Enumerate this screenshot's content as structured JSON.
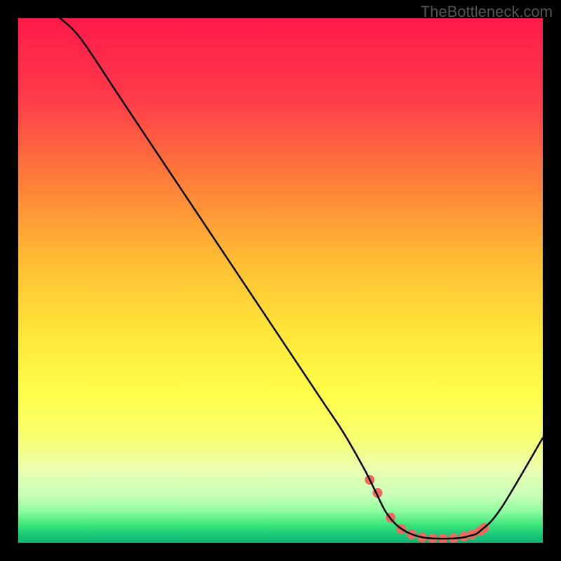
{
  "watermark": "TheBottleneck.com",
  "chart_data": {
    "type": "line",
    "title": "",
    "xlabel": "",
    "ylabel": "",
    "xlim": [
      0,
      100
    ],
    "ylim": [
      0,
      100
    ],
    "curve": {
      "x": [
        8,
        12,
        20,
        30,
        40,
        50,
        58,
        62,
        66,
        68,
        70,
        72,
        74,
        76,
        78,
        80,
        82,
        84,
        86,
        88,
        92,
        100
      ],
      "y": [
        100,
        96,
        84,
        69,
        54,
        39,
        27,
        21,
        14,
        10,
        6,
        3.5,
        2.1,
        1.3,
        0.9,
        0.8,
        0.8,
        0.9,
        1.3,
        2.2,
        6.5,
        20
      ]
    },
    "markers": {
      "x": [
        67,
        68.5,
        71,
        73,
        75,
        77,
        79,
        81,
        83,
        85,
        86.5,
        88,
        88.8
      ],
      "y": [
        12,
        9.5,
        4.8,
        2.6,
        1.6,
        1.0,
        0.8,
        0.8,
        0.9,
        1.2,
        1.6,
        2.2,
        2.8
      ]
    },
    "gradient_stops": [
      {
        "offset": 0.0,
        "color": "#ff1a4a"
      },
      {
        "offset": 0.15,
        "color": "#ff3a4a"
      },
      {
        "offset": 0.3,
        "color": "#ff7a3a"
      },
      {
        "offset": 0.45,
        "color": "#ffb933"
      },
      {
        "offset": 0.6,
        "color": "#ffe63a"
      },
      {
        "offset": 0.72,
        "color": "#ffff4a"
      },
      {
        "offset": 0.8,
        "color": "#f8ff70"
      },
      {
        "offset": 0.86,
        "color": "#eaffb0"
      },
      {
        "offset": 0.91,
        "color": "#c8ffb8"
      },
      {
        "offset": 0.94,
        "color": "#8efc9e"
      },
      {
        "offset": 0.965,
        "color": "#3de57a"
      },
      {
        "offset": 0.985,
        "color": "#18c978"
      },
      {
        "offset": 1.0,
        "color": "#0fb574"
      }
    ],
    "marker_style": {
      "fill": "#ec6b5f",
      "radius": 7
    },
    "line_style": {
      "stroke": "#000000",
      "width": 2.5
    }
  }
}
